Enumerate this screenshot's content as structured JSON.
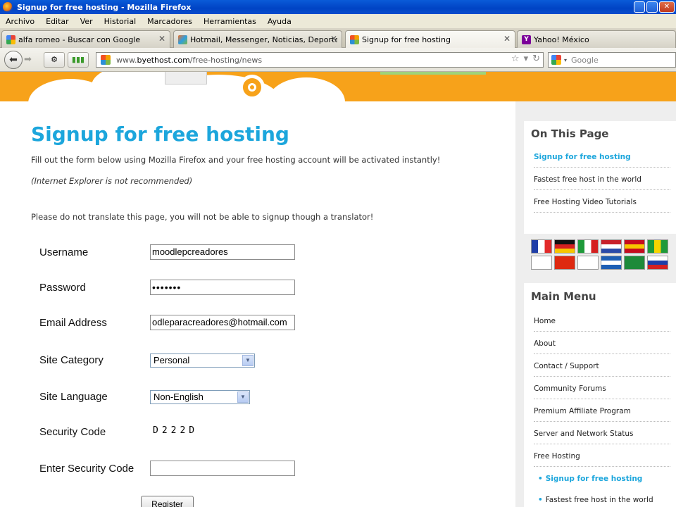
{
  "window": {
    "title": "Signup for free hosting - Mozilla Firefox"
  },
  "menu": [
    "Archivo",
    "Editar",
    "Ver",
    "Historial",
    "Marcadores",
    "Herramientas",
    "Ayuda"
  ],
  "tabs": [
    {
      "label": "alfa romeo - Buscar con Google",
      "icon": "google-icon"
    },
    {
      "label": "Hotmail, Messenger, Noticias, Deportes...",
      "icon": "msn-butterfly-icon"
    },
    {
      "label": "Signup for free hosting",
      "icon": "byethost-icon"
    },
    {
      "label": "Yahoo! México",
      "icon": "yahoo-icon"
    }
  ],
  "nav": {
    "url_prefix": "www.",
    "url_host": "byethost.com",
    "url_path": "/free-hosting/news",
    "search_placeholder": "Google"
  },
  "page": {
    "title": "Signup for free hosting",
    "intro": "Fill out the form below using Mozilla Firefox and your free hosting account will be activated instantly!",
    "ie_note": "(Internet Explorer is not recommended)",
    "translate_note": "Please do not translate this page, you will not be able to signup though a translator!"
  },
  "form": {
    "username_label": "Username",
    "username_value": "moodlepcreadores",
    "password_label": "Password",
    "password_value": "•••••••",
    "email_label": "Email Address",
    "email_value": "odleparacreadores@hotmail.com",
    "category_label": "Site Category",
    "category_value": "Personal",
    "language_label": "Site Language",
    "language_value": "Non-English",
    "security_label": "Security Code",
    "security_value": "D222D",
    "enter_security_label": "Enter Security Code",
    "enter_security_value": "",
    "register_label": "Register"
  },
  "sidebar": {
    "on_this_page_title": "On This Page",
    "on_this_page": [
      "Signup for free hosting",
      "Fastest free host in the world",
      "Free Hosting Video Tutorials"
    ],
    "flags": [
      {
        "name": "flag-france",
        "colors": [
          "#1f3ea8",
          "#ffffff",
          "#e22a2a"
        ],
        "dir": "v"
      },
      {
        "name": "flag-germany",
        "colors": [
          "#111111",
          "#d52020",
          "#f7c600"
        ],
        "dir": "h"
      },
      {
        "name": "flag-italy",
        "colors": [
          "#1e9a3a",
          "#ffffff",
          "#d52020"
        ],
        "dir": "v"
      },
      {
        "name": "flag-netherlands",
        "colors": [
          "#c8202a",
          "#ffffff",
          "#2a4aa8"
        ],
        "dir": "h"
      },
      {
        "name": "flag-spain",
        "colors": [
          "#c60b1e",
          "#f7c600",
          "#c60b1e"
        ],
        "dir": "h"
      },
      {
        "name": "flag-brazil",
        "colors": [
          "#1e9a3a",
          "#f7d400",
          "#1e9a3a"
        ],
        "dir": "v"
      },
      {
        "name": "flag-korea",
        "colors": [
          "#ffffff",
          "#ffffff",
          "#ffffff"
        ],
        "dir": "h"
      },
      {
        "name": "flag-china",
        "colors": [
          "#de2910",
          "#de2910",
          "#de2910"
        ],
        "dir": "h"
      },
      {
        "name": "flag-japan",
        "colors": [
          "#ffffff",
          "#ffffff",
          "#ffffff"
        ],
        "dir": "h"
      },
      {
        "name": "flag-greece",
        "colors": [
          "#1e5fb4",
          "#ffffff",
          "#1e5fb4"
        ],
        "dir": "h"
      },
      {
        "name": "flag-saudi",
        "colors": [
          "#1e8a3a",
          "#1e8a3a",
          "#1e8a3a"
        ],
        "dir": "h"
      },
      {
        "name": "flag-russia",
        "colors": [
          "#ffffff",
          "#1e3ea8",
          "#d52020"
        ],
        "dir": "h"
      }
    ],
    "main_menu_title": "Main Menu",
    "main_menu": [
      "Home",
      "About",
      "Contact / Support",
      "Community Forums",
      "Premium Affiliate Program",
      "Server and Network Status",
      "Free Hosting"
    ],
    "sub_menu": [
      "Signup for free hosting",
      "Fastest free host in the world"
    ]
  }
}
